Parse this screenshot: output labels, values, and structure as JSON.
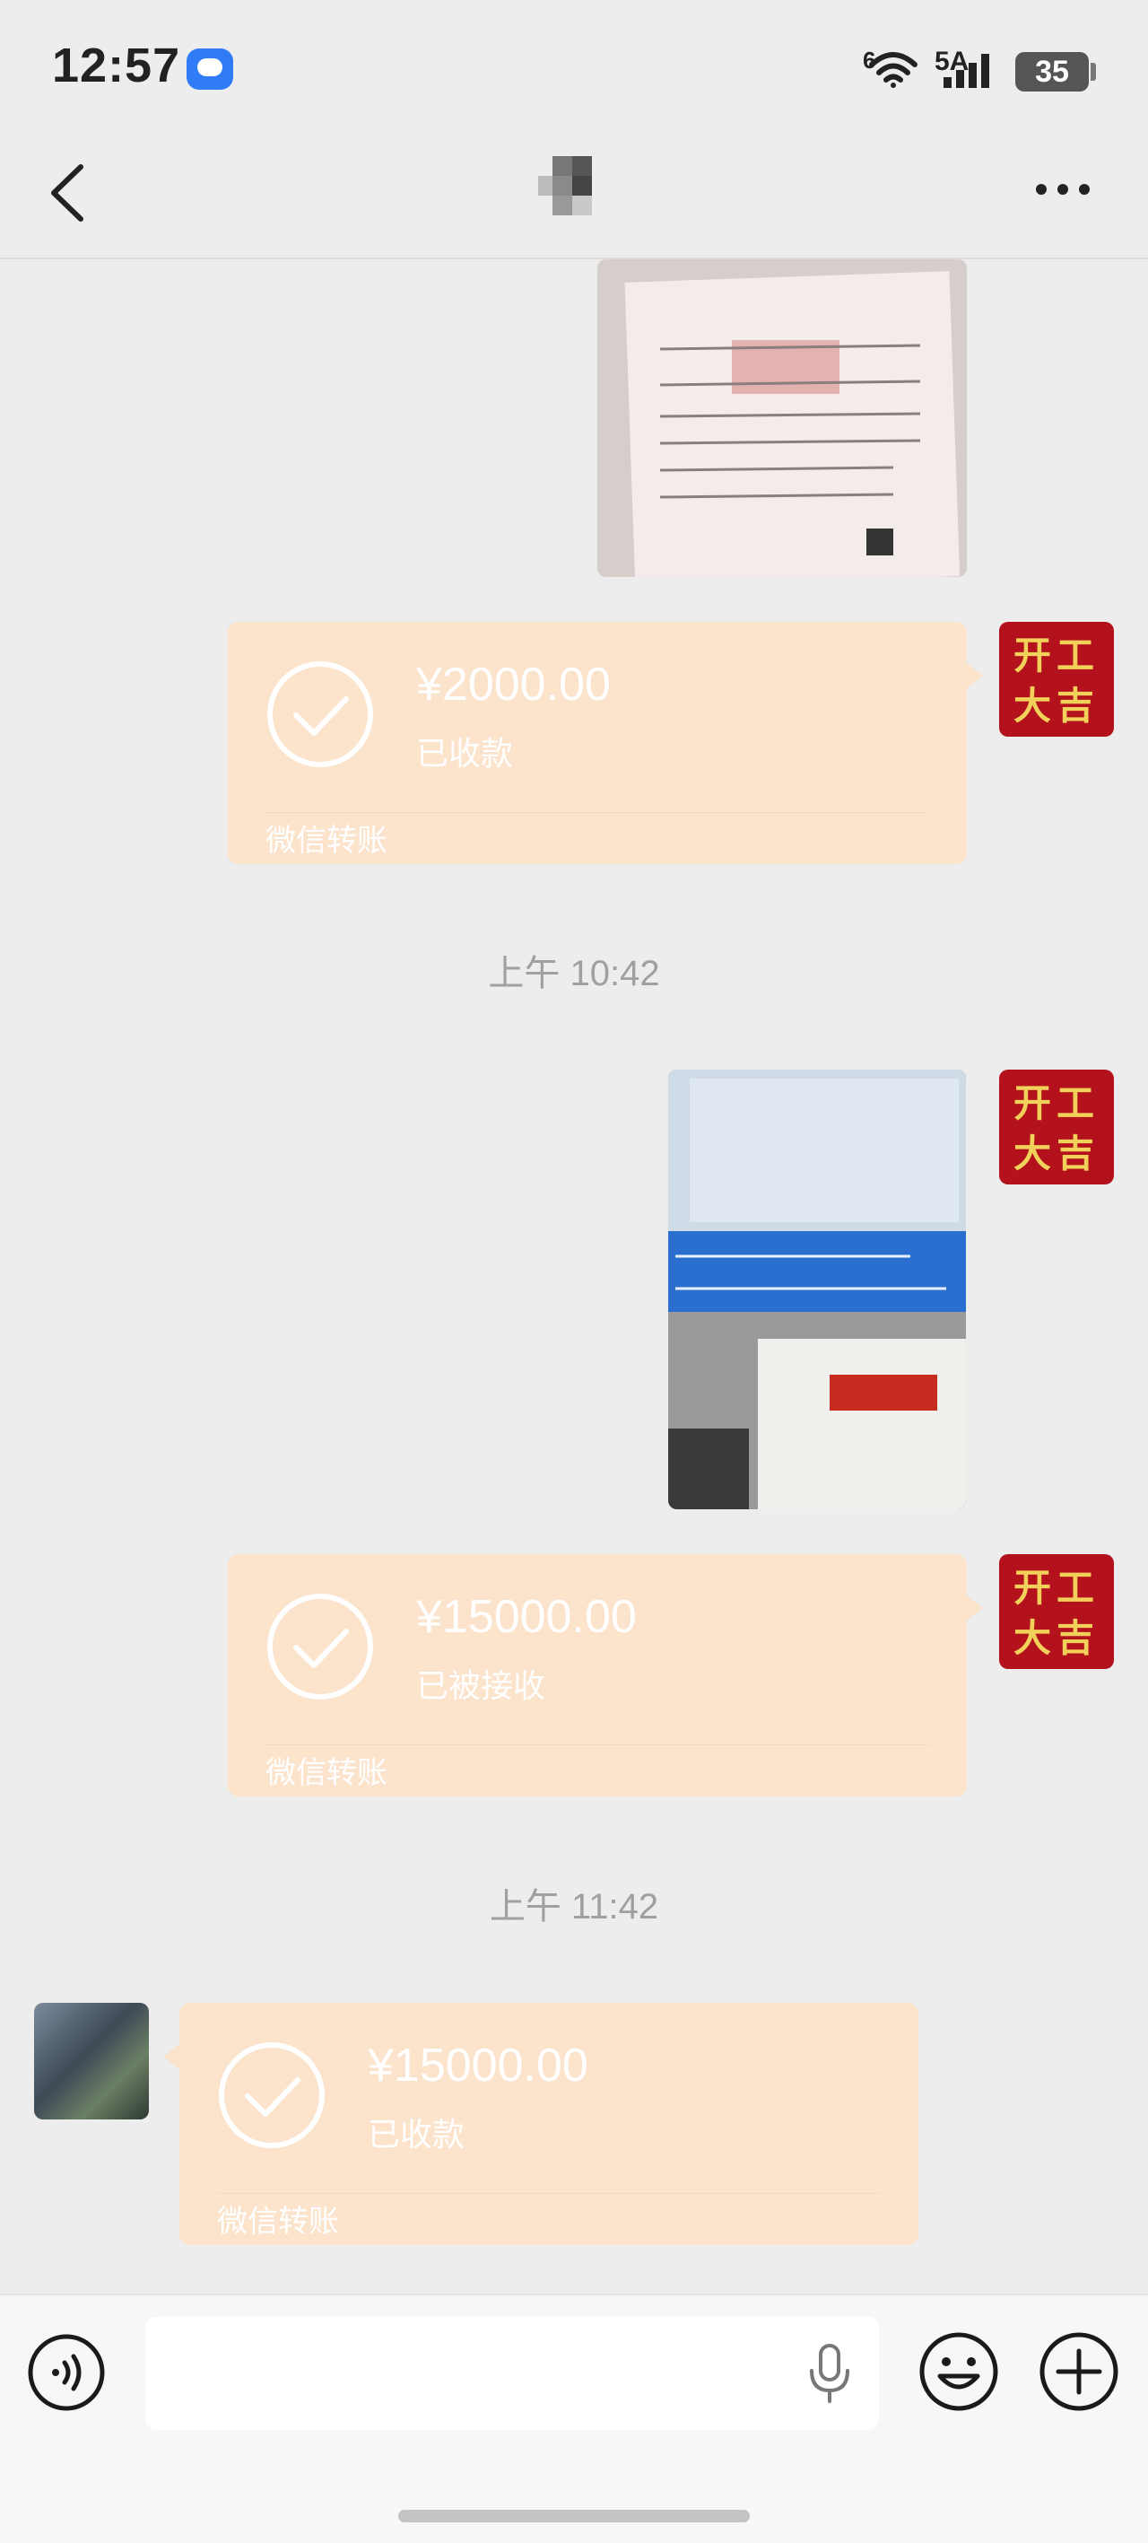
{
  "status_bar": {
    "time": "12:57",
    "wifi_label": "6",
    "network_label": "5A",
    "battery": "35"
  },
  "header": {
    "title": "",
    "back_icon": "chevron-left-icon",
    "more_icon": "more-horizontal-icon"
  },
  "messages": [
    {
      "type": "image",
      "side": "right",
      "description_icon": "photo"
    },
    {
      "type": "transfer",
      "side": "right",
      "amount": "¥2000.00",
      "status": "已收款",
      "brand": "微信转账"
    },
    {
      "type": "timestamp",
      "text": "上午 10:42"
    },
    {
      "type": "image",
      "side": "right"
    },
    {
      "type": "transfer",
      "side": "right",
      "amount": "¥15000.00",
      "status": "已被接收",
      "brand": "微信转账"
    },
    {
      "type": "timestamp",
      "text": "上午 11:42"
    },
    {
      "type": "transfer",
      "side": "left",
      "amount": "¥15000.00",
      "status": "已收款",
      "brand": "微信转账"
    }
  ],
  "avatar_me": {
    "line1": "开工",
    "line2": "大吉"
  },
  "input_bar": {
    "placeholder": "",
    "voice_icon": "voice-icon",
    "mic_icon": "mic-icon",
    "emoji_icon": "emoji-icon",
    "plus_icon": "plus-icon"
  },
  "colors": {
    "background": "#ededed",
    "transfer_bubble": "#fbe3cc",
    "avatar_red": "#b3121c",
    "avatar_gold": "#f2d15a"
  }
}
